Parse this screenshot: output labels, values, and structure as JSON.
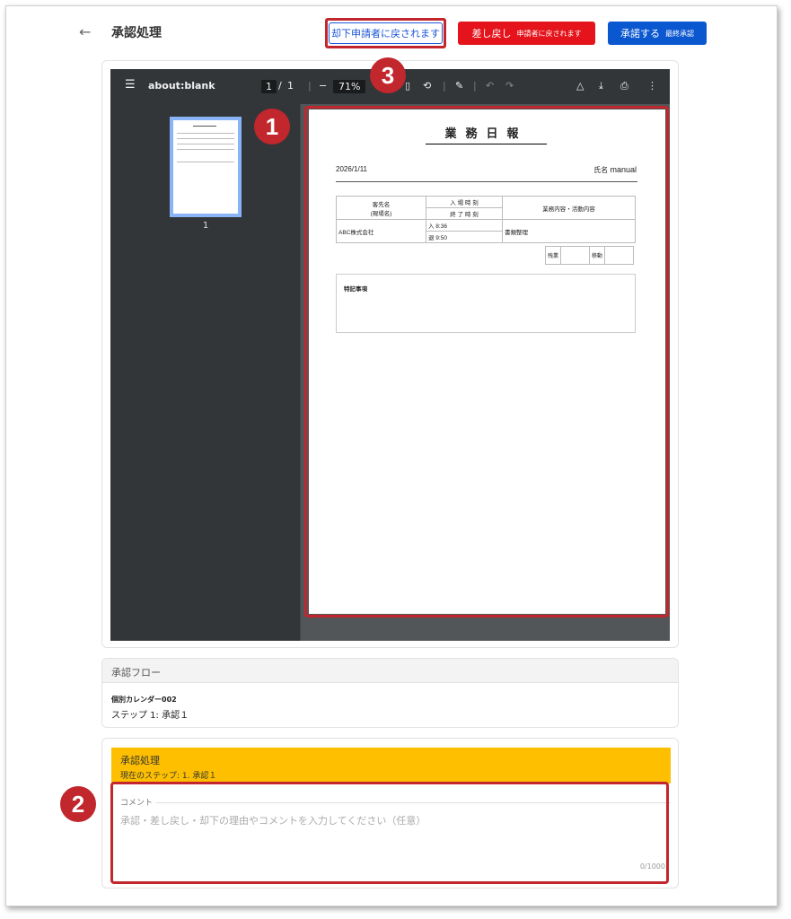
{
  "header": {
    "back_icon": "arrow-left-icon",
    "title": "承認処理",
    "reject_label": "却下",
    "reject_sub": "申請者に戻されます",
    "return_label": "差し戻し",
    "return_sub": "申請者に戻されます",
    "approve_label": "承諾する",
    "approve_sub": "最終承認"
  },
  "colors": {
    "reject": "#1a56d6",
    "return": "#e5131b",
    "approve": "#0b57d0",
    "highlight": "#c1272d",
    "process_header": "#fdbf00"
  },
  "callouts": {
    "one": "1",
    "two": "2",
    "three": "3"
  },
  "viewer": {
    "doc_title": "about:blank",
    "page_current": "1",
    "page_sep": "/",
    "page_total": "1",
    "zoom": "71%",
    "thumb_page": "1"
  },
  "document": {
    "title": "業務日報",
    "date": "2026/1/11",
    "name_label": "氏名",
    "name_value": "manual",
    "customer_header": "客先名",
    "customer_sub": "(現場名)",
    "enter_header": "入 場 時 刻",
    "exit_header": "終 了 時 刻",
    "work_header": "業務内容・活動内容",
    "customer": "ABC株式会社",
    "enter_time": "入 8:36",
    "exit_time": "退 9:50",
    "work": "書類整理",
    "overtime_label": "残業",
    "travel_label": "移動",
    "notes_label": "特記事項"
  },
  "flow": {
    "header": "承認フロー",
    "name": "個別カレンダー002",
    "step": "ステップ 1: 承認１"
  },
  "process": {
    "title": "承認処理",
    "current_step": "現在のステップ: 1. 承認１",
    "comment_label": "コメント",
    "comment_placeholder": "承認・差し戻し・却下の理由やコメントを入力してください（任意）",
    "counter": "0/1000"
  }
}
